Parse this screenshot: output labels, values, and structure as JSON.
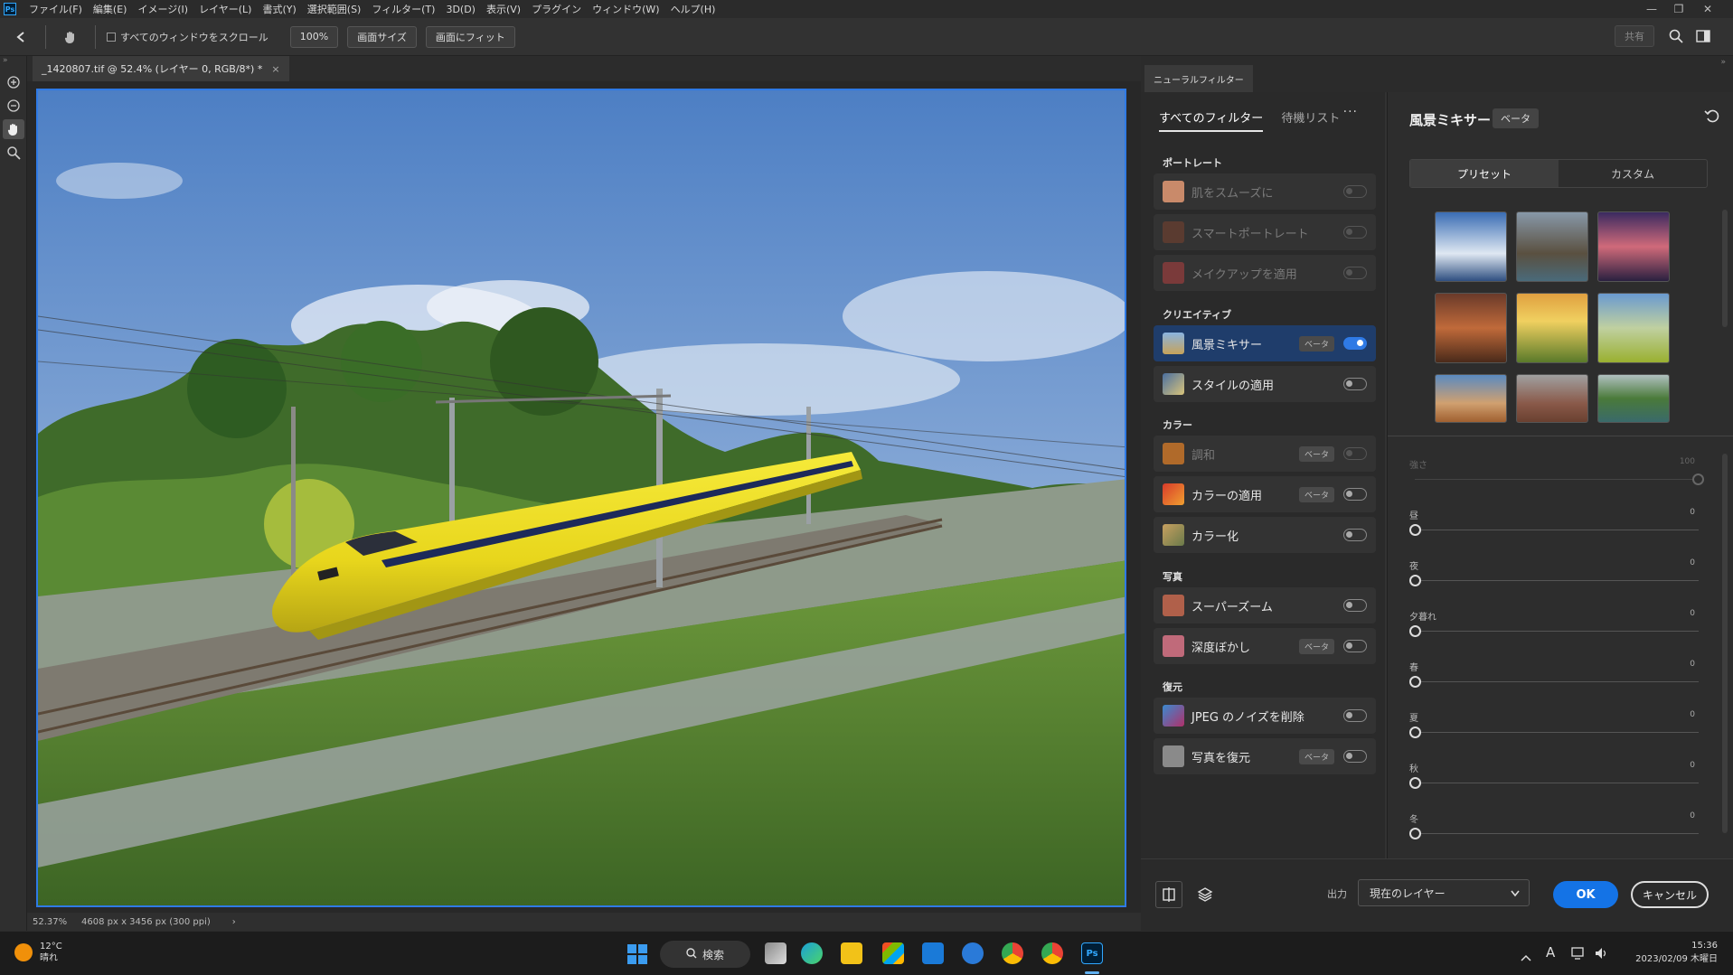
{
  "menu": {
    "items": [
      "ファイル(F)",
      "編集(E)",
      "イメージ(I)",
      "レイヤー(L)",
      "書式(Y)",
      "選択範囲(S)",
      "フィルター(T)",
      "3D(D)",
      "表示(V)",
      "プラグイン",
      "ウィンドウ(W)",
      "ヘルプ(H)"
    ],
    "ps_logo": "Ps"
  },
  "options": {
    "scroll_all_label": "すべてのウィンドウをスクロール",
    "zoom_btn": "100%",
    "fit_screen_btn": "画面サイズ",
    "fill_screen_btn": "画面にフィット",
    "share_btn": "共有"
  },
  "document": {
    "tab_title": "_1420807.tif @ 52.4% (レイヤー 0, RGB/8*) *",
    "tab_close": "×",
    "zoom_status": "52.37%",
    "size_status": "4608 px x 3456 px (300 ppi)",
    "status_arrow": "›"
  },
  "neural": {
    "panel_tab": "ニューラルフィルター",
    "tab_all": "すべてのフィルター",
    "tab_waitlist": "待機リスト",
    "more": "···",
    "categories": {
      "portrait": "ポートレート",
      "creative": "クリエイティブ",
      "color": "カラー",
      "photo": "写真",
      "restore": "復元"
    },
    "filters": {
      "smooth_skin": "肌をスムーズに",
      "smart_portrait": "スマートポートレート",
      "makeup": "メイクアップを適用",
      "landscape_mixer": "風景ミキサー",
      "style_transfer": "スタイルの適用",
      "harmonize": "調和",
      "color_transfer": "カラーの適用",
      "colorize": "カラー化",
      "super_zoom": "スーパーズーム",
      "depth_blur": "深度ぼかし",
      "jpeg_artifacts": "JPEG のノイズを削除",
      "photo_restore": "写真を復元"
    },
    "beta": "ベータ",
    "settings": {
      "title": "風景ミキサー",
      "beta": "ベータ",
      "seg_preset": "プリセット",
      "seg_custom": "カスタム",
      "sliders": [
        {
          "label": "強さ",
          "value": "100"
        },
        {
          "label": "昼",
          "value": "0"
        },
        {
          "label": "夜",
          "value": "0"
        },
        {
          "label": "夕暮れ",
          "value": "0"
        },
        {
          "label": "春",
          "value": "0"
        },
        {
          "label": "夏",
          "value": "0"
        },
        {
          "label": "秋",
          "value": "0"
        },
        {
          "label": "冬",
          "value": "0"
        }
      ]
    },
    "footer": {
      "output_label": "出力",
      "output_value": "現在のレイヤー",
      "ok": "OK",
      "cancel": "キャンセル"
    }
  },
  "taskbar": {
    "weather_temp": "12°C",
    "weather_desc": "晴れ",
    "search": "検索",
    "time": "15:36",
    "date": "2023/02/09 木曜日",
    "ime": "A"
  }
}
